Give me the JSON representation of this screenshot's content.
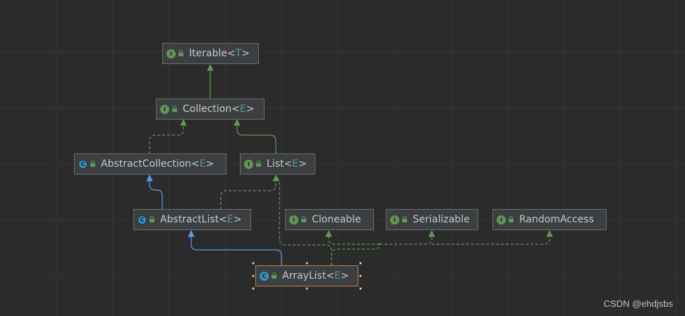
{
  "nodes": [
    {
      "id": "iterable",
      "kind": "interface",
      "kind_letter": "I",
      "name": "Iterable",
      "type_param": "T"
    },
    {
      "id": "collection",
      "kind": "interface",
      "kind_letter": "I",
      "name": "Collection",
      "type_param": "E"
    },
    {
      "id": "abstractcollection",
      "kind": "abstract-class",
      "kind_letter": "C",
      "name": "AbstractCollection",
      "type_param": "E"
    },
    {
      "id": "list",
      "kind": "interface",
      "kind_letter": "I",
      "name": "List",
      "type_param": "E"
    },
    {
      "id": "abstractlist",
      "kind": "abstract-class",
      "kind_letter": "C",
      "name": "AbstractList",
      "type_param": "E"
    },
    {
      "id": "cloneable",
      "kind": "interface",
      "kind_letter": "I",
      "name": "Cloneable",
      "type_param": ""
    },
    {
      "id": "serializable",
      "kind": "interface",
      "kind_letter": "I",
      "name": "Serializable",
      "type_param": ""
    },
    {
      "id": "randomaccess",
      "kind": "interface",
      "kind_letter": "I",
      "name": "RandomAccess",
      "type_param": ""
    },
    {
      "id": "arraylist",
      "kind": "class",
      "kind_letter": "C",
      "name": "ArrayList",
      "type_param": "E",
      "selected": true
    }
  ],
  "edges": [
    {
      "from": "collection",
      "to": "iterable",
      "type": "extends-interface"
    },
    {
      "from": "abstractcollection",
      "to": "collection",
      "type": "implements"
    },
    {
      "from": "list",
      "to": "collection",
      "type": "extends-interface"
    },
    {
      "from": "abstractlist",
      "to": "abstractcollection",
      "type": "extends-class"
    },
    {
      "from": "abstractlist",
      "to": "list",
      "type": "implements"
    },
    {
      "from": "arraylist",
      "to": "abstractlist",
      "type": "extends-class"
    },
    {
      "from": "arraylist",
      "to": "list",
      "type": "implements"
    },
    {
      "from": "arraylist",
      "to": "cloneable",
      "type": "implements"
    },
    {
      "from": "arraylist",
      "to": "serializable",
      "type": "implements"
    },
    {
      "from": "arraylist",
      "to": "randomaccess",
      "type": "implements"
    }
  ],
  "colors": {
    "background": "#2b2b2b",
    "interface_badge": "#629755",
    "class_badge": "#3592c4",
    "extends_class_line": "#5a9cf0",
    "interface_line": "#5f9a55",
    "selected_border": "#c27e3c"
  },
  "watermark": "CSDN @ehdjsbs"
}
